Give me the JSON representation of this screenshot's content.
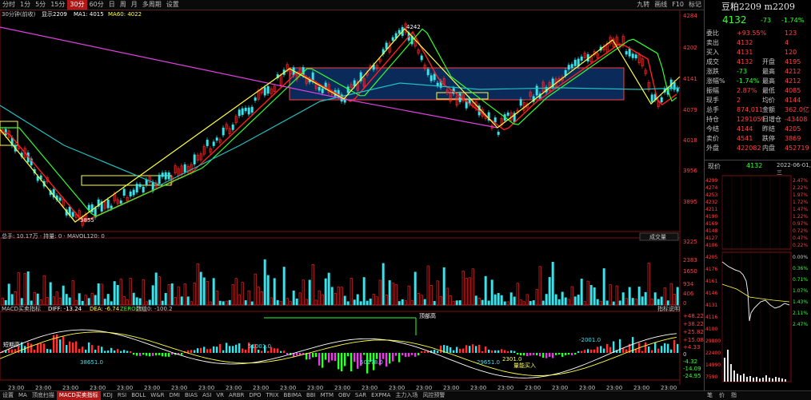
{
  "toolbar": {
    "periods": [
      "分时",
      "1分",
      "5分",
      "15分",
      "30分",
      "60分",
      "日",
      "周",
      "月",
      "多周期",
      "设置"
    ],
    "active_period": "30分",
    "right_items": [
      "九转",
      "画线",
      "F10",
      "标记"
    ]
  },
  "main_chart": {
    "legend_title": "30分钟(前收)",
    "ma_labels": [
      "显示2209",
      "MA1: 4015",
      "MA60: 4022"
    ],
    "price_labels": [
      "4284",
      "4202",
      "4141",
      "4079",
      "4018",
      "3956",
      "3895"
    ],
    "high_mark": "4242",
    "low_mark": "3855",
    "colors": {
      "up": "#ff3030",
      "down": "#40e0e8",
      "ma_red": "#ff2020",
      "ma_green": "#30ff30",
      "ma_cyan": "#20c0c0",
      "trend": "#ffff40",
      "channel": "#e040e0"
    }
  },
  "volume_chart": {
    "legend": "总手: 10.17万 · 持量: 0 · MAVOL120: 0",
    "selector": "成交量",
    "labels": [
      "3225",
      "2383",
      "1650",
      "934",
      "406",
      "0"
    ]
  },
  "macd_chart": {
    "legend_name": "MACD买卖指标",
    "legend_diff": "DIFF: -13.24",
    "legend_dea": "DEA: -6.74",
    "legend_zero": "ZERO: 0",
    "legend_extra": "数值0: -100.2",
    "right_note": "指标说明",
    "labels": [
      "+48.22",
      "+38.22",
      "+25.82",
      "+15.08",
      "+4.33",
      "0",
      "-4.32",
      "-14.09",
      "-24.95"
    ],
    "annotations": [
      "短期高",
      "51001.0",
      "38651.0",
      "50178.0",
      "29651.0",
      "2301.0",
      "-2001.0",
      "量能买入",
      "顶部高"
    ]
  },
  "time_axis": [
    "23:00",
    "23:00",
    "23:00",
    "23:00",
    "23:00",
    "23:00",
    "23:00",
    "23:00",
    "23:00",
    "23:00",
    "23:00",
    "23:00",
    "23:00",
    "23:00",
    "23:00",
    "23:00",
    "23:00",
    "23:00",
    "23:00",
    "23:00",
    "23:00",
    "23:00",
    "23:00",
    "23:00",
    "23:00"
  ],
  "bottom_tabs": [
    "设置",
    "MA",
    "顶底扫描",
    "MACD买卖指标",
    "KDJ",
    "RSI",
    "BOLL",
    "W&R",
    "DMI",
    "BIAS",
    "ASI",
    "VR",
    "ARBR",
    "DPO",
    "TRIX",
    "BBIMA",
    "BBI",
    "MTM",
    "OBV",
    "SAR",
    "EXPMA",
    "主力入场",
    "风控预警"
  ],
  "bottom_tab_active": "MACD买卖指标",
  "quote_panel": {
    "title": "豆粕2209 m2209",
    "price": "4132",
    "change": "-73",
    "change_pct": "-1.74%",
    "rows": [
      {
        "label": "委比",
        "value": "+93.55%",
        "label2": "",
        "value2": "123"
      },
      {
        "label": "卖出",
        "value": "4132",
        "label2": "",
        "value2": "4"
      },
      {
        "label": "买入",
        "value": "4131",
        "label2": "",
        "value2": "120"
      },
      {
        "label": "成交",
        "value": "4132",
        "label2": "开盘",
        "value2": "4195"
      },
      {
        "label": "涨跌",
        "value": "-73",
        "label2": "最高",
        "value2": "4212"
      },
      {
        "label": "涨幅%",
        "value": "-1.74%",
        "label2": "最高",
        "value2": "4212"
      },
      {
        "label": "振幅",
        "value": "2.87%",
        "label2": "最低",
        "value2": "4085"
      },
      {
        "label": "现手",
        "value": "2",
        "label2": "均价",
        "value2": "4144"
      },
      {
        "label": "总手",
        "value": "874,011",
        "label2": "金额",
        "value2": "362.0亿"
      },
      {
        "label": "持仓",
        "value": "1291059",
        "label2": "日增仓",
        "value2": "-43408"
      },
      {
        "label": "今结",
        "value": "4144",
        "label2": "昨结",
        "value2": "4205"
      },
      {
        "label": "卖价",
        "value": "4541",
        "label2": "跌停",
        "value2": "3869"
      },
      {
        "label": "外盘",
        "value": "422082",
        "label2": "内盘",
        "value2": "452719"
      }
    ],
    "info_label": "现价",
    "info_price": "4132",
    "info_date": "2022-06-01, 三",
    "mini_left": [
      "4299",
      "4274",
      "4253",
      "4232",
      "4211",
      "4190",
      "4169",
      "4148",
      "4127",
      "4106"
    ],
    "mini_right": [
      "2.47%",
      "2.22%",
      "1.97%",
      "1.72%",
      "1.47%",
      "1.22%",
      "0.97%",
      "0.72%",
      "0.47%",
      "0.22%"
    ],
    "mini2_left": [
      "4205",
      "4176",
      "4161",
      "4146",
      "4131",
      "4116",
      "4100",
      "29800",
      "22400",
      "14990",
      "7590"
    ],
    "mini2_right": [
      "0.00%",
      "0.36%",
      "0.71%",
      "1.07%",
      "1.43%",
      "2.11%",
      "2.47%"
    ],
    "bottom_tabs": [
      "笔",
      "价",
      "指"
    ]
  }
}
